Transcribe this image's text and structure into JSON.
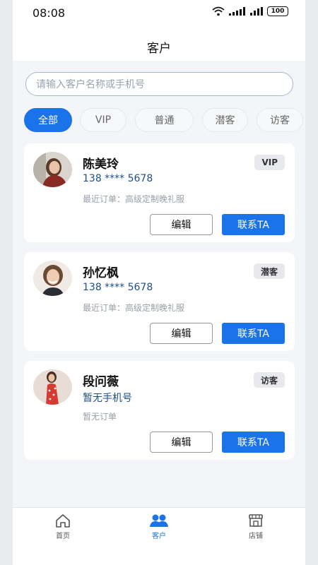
{
  "status_bar": {
    "time": "08:08",
    "battery": "100"
  },
  "header": {
    "title": "客户"
  },
  "search": {
    "placeholder": "请输入客户名称或手机号"
  },
  "filters": [
    "全部",
    "VIP",
    "普通",
    "潜客",
    "访客"
  ],
  "active_filter": "全部",
  "customers": [
    {
      "name": "陈美玲",
      "phone": "138 **** 5678",
      "last_order": "最近订单：高级定制晚礼服",
      "tag": "VIP"
    },
    {
      "name": "孙忆枫",
      "phone": "138 **** 5678",
      "last_order": "最近订单：高级定制晚礼服",
      "tag": "潜客"
    },
    {
      "name": "段问薇",
      "phone": "暂无手机号",
      "last_order": "暂无订单",
      "tag": "访客"
    }
  ],
  "actions": {
    "edit": "编辑",
    "contact": "联系TA"
  },
  "tabbar": [
    {
      "label": "首页",
      "icon": "home-icon"
    },
    {
      "label": "客户",
      "icon": "customers-icon"
    },
    {
      "label": "店铺",
      "icon": "store-icon"
    }
  ],
  "colors": {
    "accent": "#1a73e8",
    "phone_text": "#1f4e87",
    "background": "#f4f5f8"
  }
}
